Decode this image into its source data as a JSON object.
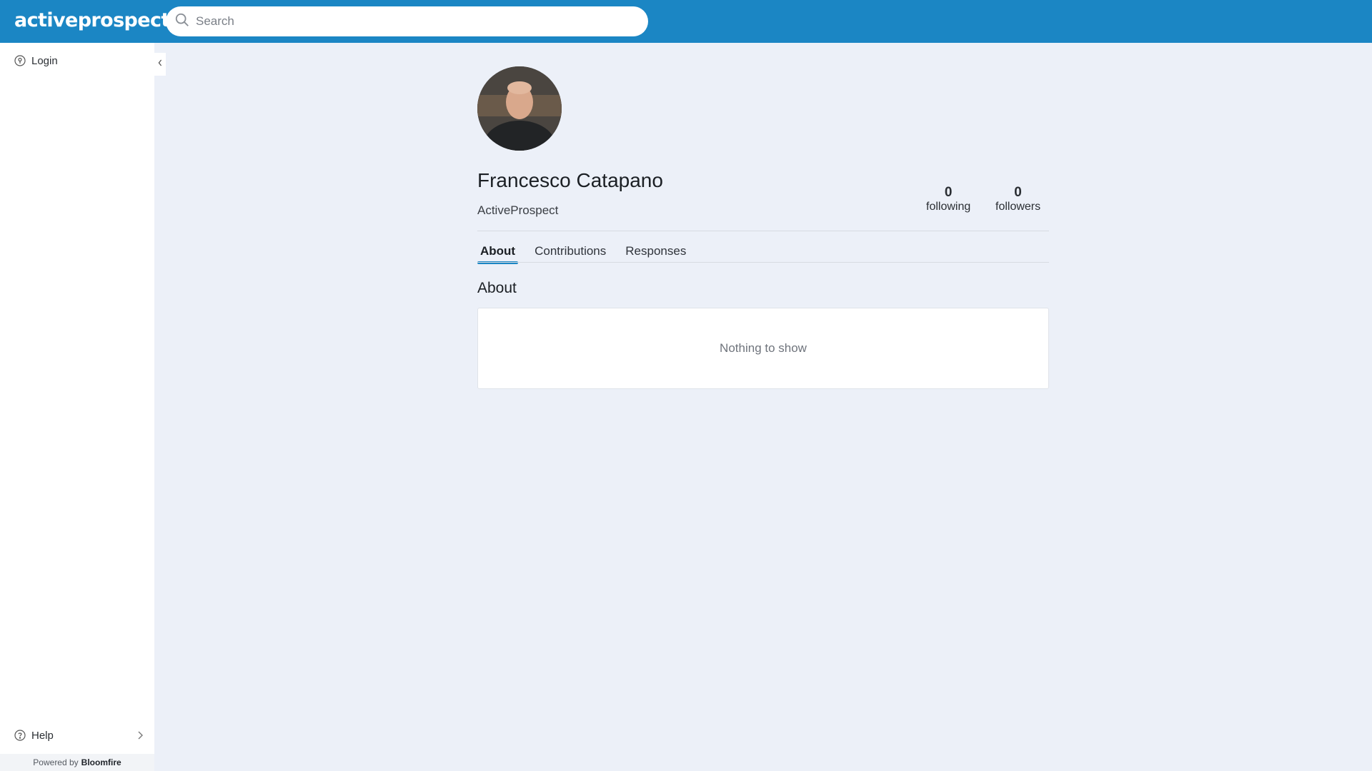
{
  "header": {
    "logo_text": "activeprospect",
    "search_placeholder": "Search",
    "brand_color": "#1b86c4"
  },
  "sidebar": {
    "login_label": "Login",
    "help_label": "Help",
    "powered_by_prefix": "Powered by",
    "powered_by_brand": "Bloomfire"
  },
  "profile": {
    "name": "Francesco Catapano",
    "organization": "ActiveProspect",
    "stats": {
      "following_count": "0",
      "following_label": "following",
      "followers_count": "0",
      "followers_label": "followers"
    },
    "tabs": [
      {
        "label": "About",
        "active": true
      },
      {
        "label": "Contributions",
        "active": false
      },
      {
        "label": "Responses",
        "active": false
      }
    ],
    "section_title": "About",
    "empty_message": "Nothing to show"
  }
}
